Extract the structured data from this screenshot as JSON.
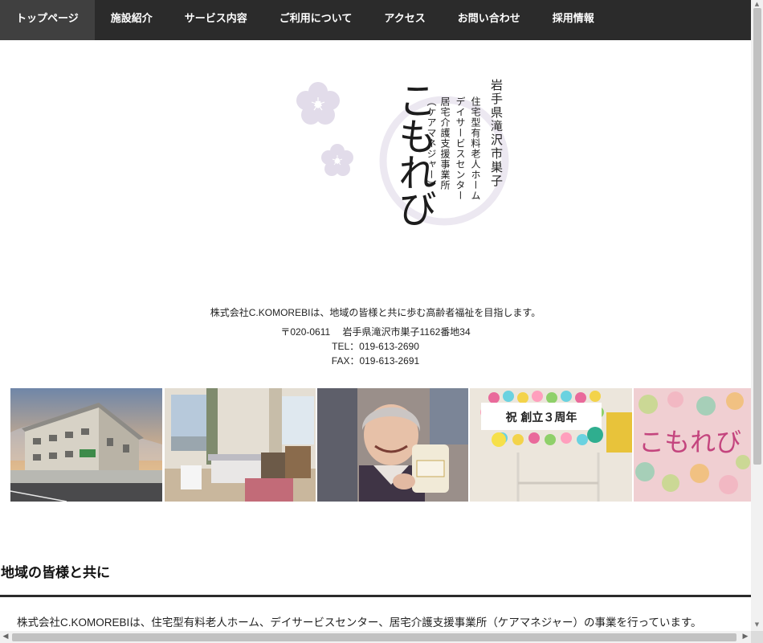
{
  "nav": {
    "items": [
      {
        "label": "トップページ",
        "active": true
      },
      {
        "label": "施設紹介"
      },
      {
        "label": "サービス内容"
      },
      {
        "label": "ご利用について"
      },
      {
        "label": "アクセス"
      },
      {
        "label": "お問い合わせ"
      },
      {
        "label": "採用情報"
      }
    ]
  },
  "logo": {
    "location": "岩手県滝沢市巣子",
    "services": [
      "住宅型有料老人ホーム",
      "デイサービスセンター",
      "居宅介護支援事業所",
      "（ケアマネジャー）"
    ],
    "brand": "こもれび"
  },
  "company": {
    "tagline": "株式会社C.KOMOREBIは、地域の皆様と共に歩む高齢者福祉を目指します。",
    "address": "〒020-0611　 岩手県滝沢市巣子1162番地34",
    "tel": "TEL：019-613-2690",
    "fax": "FAX：019-613-2691"
  },
  "photos": {
    "anniversary_banner": "祝 創立３周年",
    "mural_text": "こもれび"
  },
  "section": {
    "title": "地域の皆様と共に",
    "body": "株式会社C.KOMOREBIは、住宅型有料老人ホーム、デイサービスセンター、居宅介護支援事業所（ケアマネジャー）の事業を行っています。"
  },
  "colors": {
    "nav_bg": "#2b2b2b",
    "nav_active": "#404040",
    "blossom": "#e2dcea",
    "rule": "#2b2b2b"
  }
}
